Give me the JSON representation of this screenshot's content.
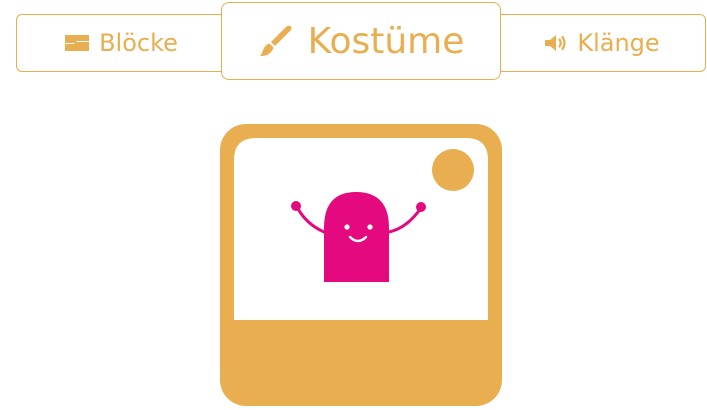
{
  "tabs": [
    {
      "label": "Blöcke",
      "icon": "blocks-icon",
      "selected": false
    },
    {
      "label": "Kostüme",
      "icon": "paintbrush-icon",
      "selected": true
    },
    {
      "label": "Klänge",
      "icon": "speaker-icon",
      "selected": false
    }
  ],
  "colors": {
    "accent": "#e9ae4f",
    "character": "#e5097f",
    "background": "#ffffff"
  },
  "illustration": {
    "icon": "costume-picture-icon",
    "content": "smiling-character-with-raised-arms"
  }
}
